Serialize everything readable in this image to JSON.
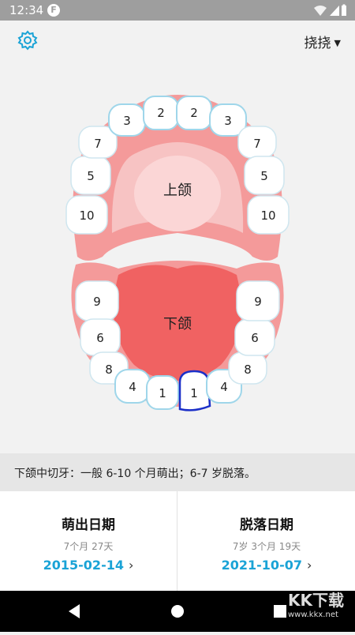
{
  "status_bar": {
    "time": "12:34",
    "app_icon_letter": "F"
  },
  "toolbar": {
    "user_name": "挠挠"
  },
  "jaw": {
    "upper_label": "上颌",
    "lower_label": "下颌",
    "upper_teeth": [
      "10",
      "5",
      "7",
      "3",
      "2",
      "2",
      "3",
      "7",
      "5",
      "10"
    ],
    "lower_teeth": [
      "9",
      "6",
      "8",
      "4",
      "1",
      "1",
      "4",
      "8",
      "6",
      "9"
    ],
    "selected_tooth": "lower central incisor (right)"
  },
  "info_text": "下颌中切牙：一般 6-10 个月萌出；6-7 岁脱落。",
  "eruption": {
    "title": "萌出日期",
    "age": "7个月 27天",
    "date": "2015-02-14"
  },
  "shedding": {
    "title": "脱落日期",
    "age": "7岁 3个月 19天",
    "date": "2021-10-07"
  },
  "watermark": {
    "text": "KK下载",
    "url": "www.kkx.net"
  },
  "colors": {
    "accent": "#1aa3d6",
    "gum": "#f49a9a",
    "palate": "#f7c3c3",
    "tongue": "#f06262",
    "selected_outline": "#1b2fc8"
  }
}
